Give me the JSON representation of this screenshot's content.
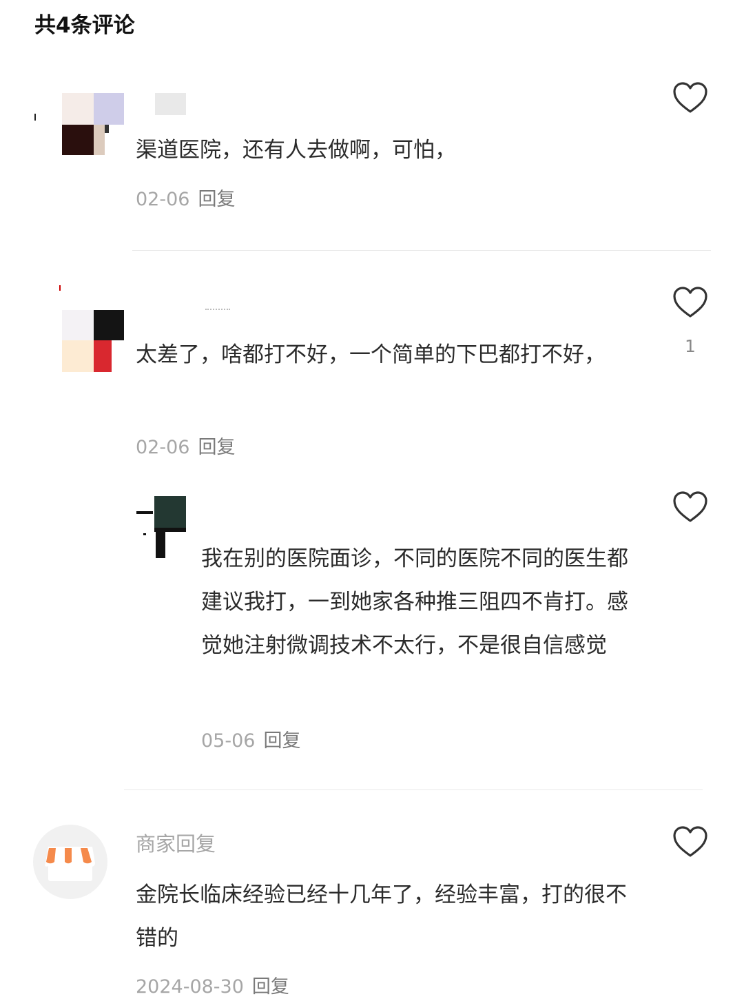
{
  "header": {
    "title": "共4条评论"
  },
  "comments": [
    {
      "text": "渠道医院，还有人去做啊，可怕，",
      "date": "02-06",
      "reply_label": "回复",
      "likes": ""
    },
    {
      "text": "太差了，啥都打不好，一个简单的下巴都打不好，",
      "date": "02-06",
      "reply_label": "回复",
      "likes": "1"
    }
  ],
  "nested_reply": {
    "text": "我在别的医院面诊，不同的医院不同的医生都建议我打，一到她家各种推三阻四不肯打。感觉她注射微调技术不太行，不是很自信感觉",
    "date": "05-06",
    "reply_label": "回复"
  },
  "merchant_reply": {
    "name": "商家回复",
    "text": "金院长临床经验已经十几年了，经验丰富，打的很不错的",
    "date": "2024-08-30",
    "reply_label": "回复",
    "icon": "storefront-icon"
  },
  "colors": {
    "like_outline": "#333333",
    "awning_orange": "#f58a4b",
    "divider": "#e8e8e8"
  }
}
